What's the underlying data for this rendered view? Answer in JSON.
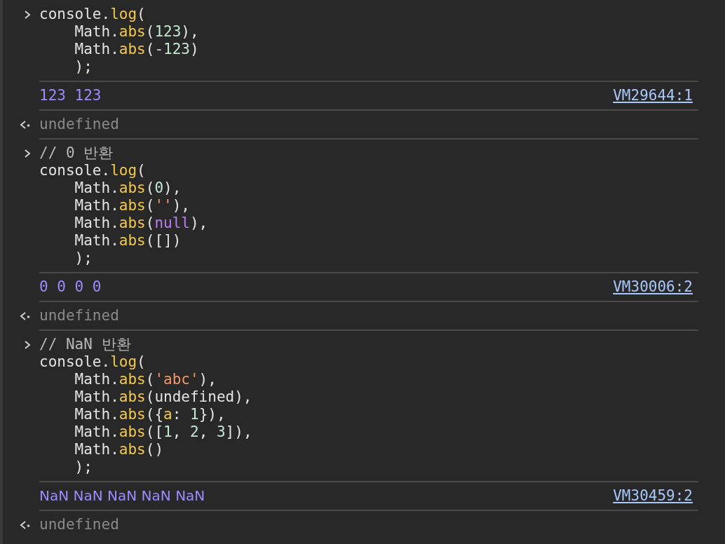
{
  "entries": [
    {
      "kind": "input",
      "lines": [
        [
          {
            "kind": "plain",
            "text": "console."
          },
          {
            "kind": "fn",
            "text": "log"
          },
          {
            "kind": "plain",
            "text": "("
          }
        ],
        [
          {
            "kind": "plain",
            "text": "    Math."
          },
          {
            "kind": "fn",
            "text": "abs"
          },
          {
            "kind": "plain",
            "text": "("
          },
          {
            "kind": "number",
            "text": "123"
          },
          {
            "kind": "plain",
            "text": "),"
          }
        ],
        [
          {
            "kind": "plain",
            "text": "    Math."
          },
          {
            "kind": "fn",
            "text": "abs"
          },
          {
            "kind": "plain",
            "text": "("
          },
          {
            "kind": "number",
            "text": "-123"
          },
          {
            "kind": "plain",
            "text": ")"
          }
        ],
        [
          {
            "kind": "plain",
            "text": "    );"
          }
        ]
      ]
    },
    {
      "kind": "output",
      "value": {
        "kind": "number",
        "text": "123 123"
      },
      "source": "VM29644:1"
    },
    {
      "kind": "result",
      "text": "undefined"
    },
    {
      "kind": "input",
      "lines": [
        [
          {
            "kind": "comment",
            "text": "// 0 반환"
          }
        ],
        [
          {
            "kind": "plain",
            "text": "console."
          },
          {
            "kind": "fn",
            "text": "log"
          },
          {
            "kind": "plain",
            "text": "("
          }
        ],
        [
          {
            "kind": "plain",
            "text": "    Math."
          },
          {
            "kind": "fn",
            "text": "abs"
          },
          {
            "kind": "plain",
            "text": "("
          },
          {
            "kind": "number",
            "text": "0"
          },
          {
            "kind": "plain",
            "text": "),"
          }
        ],
        [
          {
            "kind": "plain",
            "text": "    Math."
          },
          {
            "kind": "fn",
            "text": "abs"
          },
          {
            "kind": "plain",
            "text": "("
          },
          {
            "kind": "string",
            "text": "''"
          },
          {
            "kind": "plain",
            "text": "),"
          }
        ],
        [
          {
            "kind": "plain",
            "text": "    Math."
          },
          {
            "kind": "fn",
            "text": "abs"
          },
          {
            "kind": "plain",
            "text": "("
          },
          {
            "kind": "keyword",
            "text": "null"
          },
          {
            "kind": "plain",
            "text": "),"
          }
        ],
        [
          {
            "kind": "plain",
            "text": "    Math."
          },
          {
            "kind": "fn",
            "text": "abs"
          },
          {
            "kind": "plain",
            "text": "([])"
          }
        ],
        [
          {
            "kind": "plain",
            "text": "    );"
          }
        ]
      ]
    },
    {
      "kind": "output",
      "value": {
        "kind": "number",
        "text": "0 0 0 0"
      },
      "source": "VM30006:2"
    },
    {
      "kind": "result",
      "text": "undefined"
    },
    {
      "kind": "input",
      "lines": [
        [
          {
            "kind": "comment",
            "text": "// NaN 반환"
          }
        ],
        [
          {
            "kind": "plain",
            "text": "console."
          },
          {
            "kind": "fn",
            "text": "log"
          },
          {
            "kind": "plain",
            "text": "("
          }
        ],
        [
          {
            "kind": "plain",
            "text": "    Math."
          },
          {
            "kind": "fn",
            "text": "abs"
          },
          {
            "kind": "plain",
            "text": "("
          },
          {
            "kind": "string",
            "text": "'abc'"
          },
          {
            "kind": "plain",
            "text": "),"
          }
        ],
        [
          {
            "kind": "plain",
            "text": "    Math."
          },
          {
            "kind": "fn",
            "text": "abs"
          },
          {
            "kind": "plain",
            "text": "(undefined),"
          }
        ],
        [
          {
            "kind": "plain",
            "text": "    Math."
          },
          {
            "kind": "fn",
            "text": "abs"
          },
          {
            "kind": "plain",
            "text": "({"
          },
          {
            "kind": "fn",
            "text": "a"
          },
          {
            "kind": "plain",
            "text": ": "
          },
          {
            "kind": "number",
            "text": "1"
          },
          {
            "kind": "plain",
            "text": "}),"
          }
        ],
        [
          {
            "kind": "plain",
            "text": "    Math."
          },
          {
            "kind": "fn",
            "text": "abs"
          },
          {
            "kind": "plain",
            "text": "(["
          },
          {
            "kind": "number",
            "text": "1"
          },
          {
            "kind": "plain",
            "text": ", "
          },
          {
            "kind": "number",
            "text": "2"
          },
          {
            "kind": "plain",
            "text": ", "
          },
          {
            "kind": "number",
            "text": "3"
          },
          {
            "kind": "plain",
            "text": "]),"
          }
        ],
        [
          {
            "kind": "plain",
            "text": "    Math."
          },
          {
            "kind": "fn",
            "text": "abs"
          },
          {
            "kind": "plain",
            "text": "()"
          }
        ],
        [
          {
            "kind": "plain",
            "text": "    );"
          }
        ]
      ]
    },
    {
      "kind": "output",
      "value": {
        "kind": "nan",
        "text": "NaN NaN NaN NaN NaN"
      },
      "source": "VM30459:2"
    },
    {
      "kind": "result",
      "text": "undefined"
    }
  ]
}
